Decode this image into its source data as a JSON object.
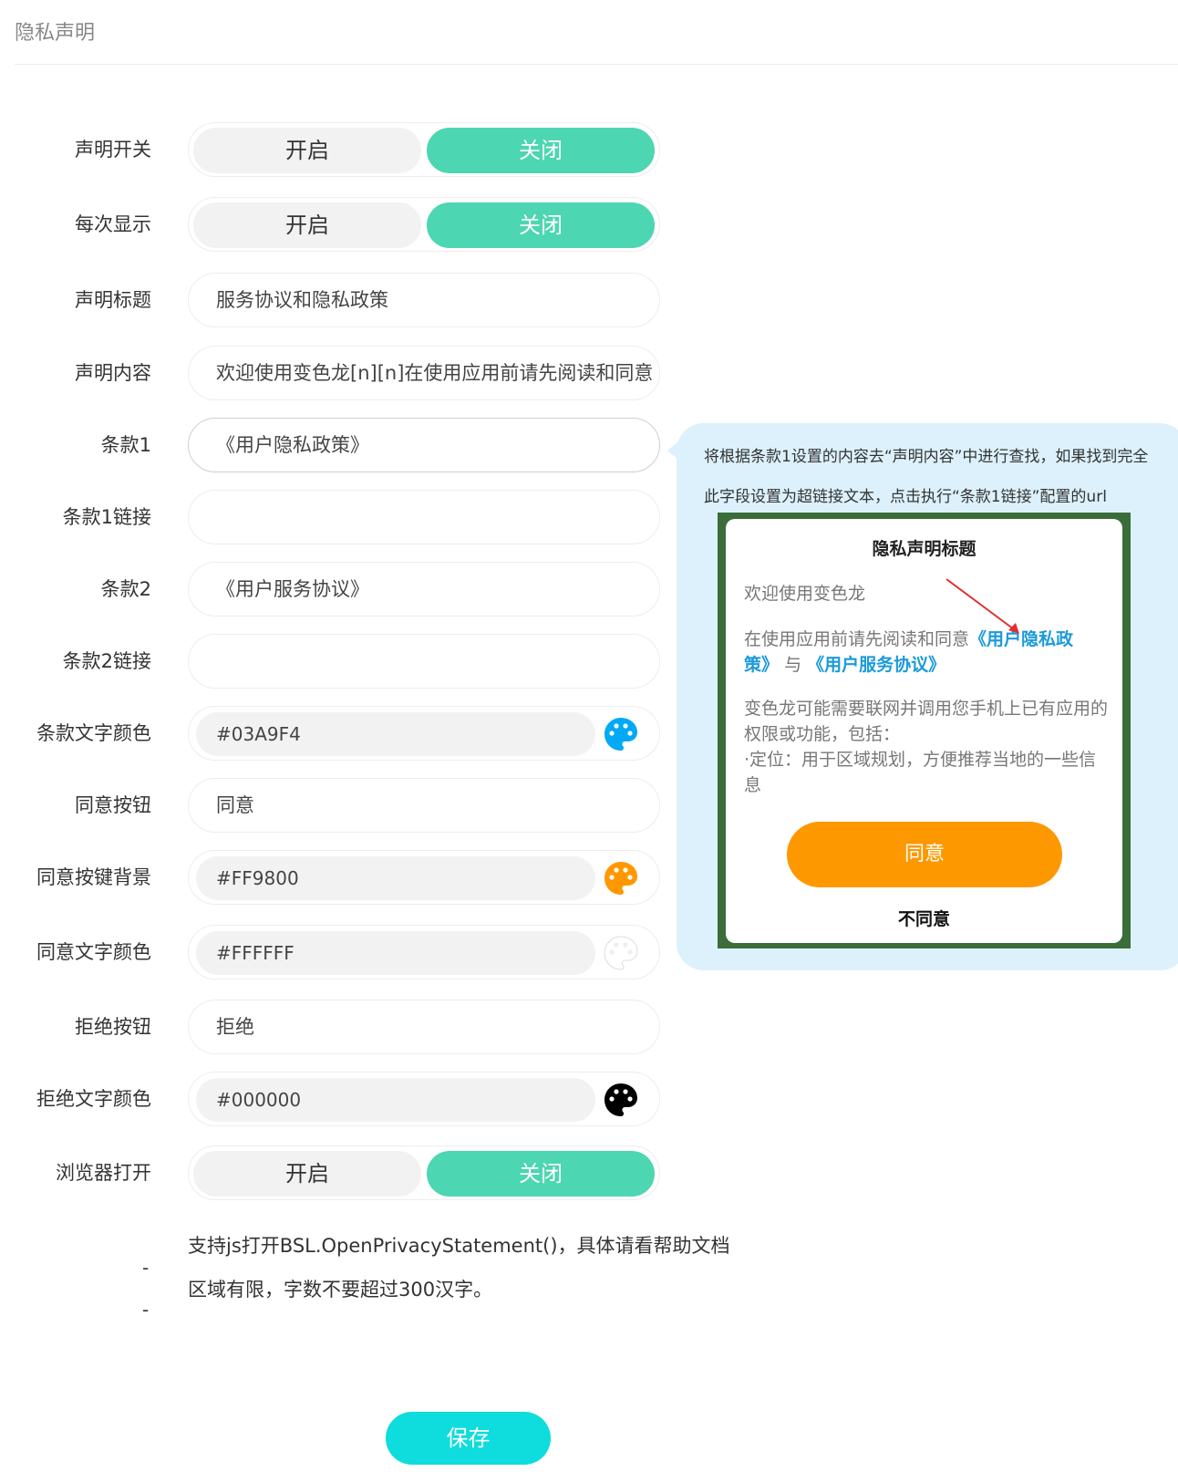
{
  "page": {
    "title": "隐私声明"
  },
  "form": {
    "switch_on": "开启",
    "switch_off": "关闭",
    "statement_switch": {
      "label": "声明开关",
      "value": "关闭"
    },
    "show_every_time": {
      "label": "每次显示",
      "value": "关闭"
    },
    "statement_title": {
      "label": "声明标题",
      "value": "服务协议和隐私政策"
    },
    "statement_content": {
      "label": "声明内容",
      "value": "欢迎使用变色龙[n][n]在使用应用前请先阅读和同意"
    },
    "clause1": {
      "label": "条款1",
      "value": "《用户隐私政策》"
    },
    "clause1_link": {
      "label": "条款1链接",
      "value": ""
    },
    "clause2": {
      "label": "条款2",
      "value": "《用户服务协议》"
    },
    "clause2_link": {
      "label": "条款2链接",
      "value": ""
    },
    "clause_text_color": {
      "label": "条款文字颜色",
      "value": "#03A9F4",
      "swatch": "#03A9F4"
    },
    "agree_button": {
      "label": "同意按钮",
      "value": "同意"
    },
    "agree_bg": {
      "label": "同意按键背景",
      "value": "#FF9800",
      "swatch": "#FF9800"
    },
    "agree_text_color": {
      "label": "同意文字颜色",
      "value": "#FFFFFF",
      "swatch": "#FFFFFF"
    },
    "refuse_button": {
      "label": "拒绝按钮",
      "value": "拒绝"
    },
    "refuse_text_color": {
      "label": "拒绝文字颜色",
      "value": "#000000",
      "swatch": "#000000"
    },
    "browser_open": {
      "label": "浏览器打开",
      "value": "关闭"
    },
    "notes": [
      {
        "dash": "-",
        "text": "支持js打开BSL.OpenPrivacyStatement()，具体请看帮助文档"
      },
      {
        "dash": "-",
        "text": "区域有限，字数不要超过300汉字。"
      }
    ],
    "save_label": "保存"
  },
  "tooltip": {
    "line1": "将根据条款1设置的内容去“声明内容”中进行查找，如果找到完全",
    "line2": "此字段设置为超链接文本，点击执行“条款1链接”配置的url",
    "preview": {
      "title": "隐私声明标题",
      "welcome": "欢迎使用变色龙",
      "read_prefix": "在使用应用前请先阅读和同意",
      "link1": "《用户隐私政策》",
      "and": "与",
      "link2": "《用户服务协议》",
      "body1": "变色龙可能需要联网并调用您手机上已有应用的权限或功能，包括：",
      "body2": "·定位：用于区域规划，方便推荐当地的一些信息",
      "agree": "同意",
      "refuse": "不同意"
    }
  },
  "colors": {
    "accent": "#4CD6B1",
    "save": "#0FDCDC",
    "tip_bg": "#DCF1FB"
  }
}
